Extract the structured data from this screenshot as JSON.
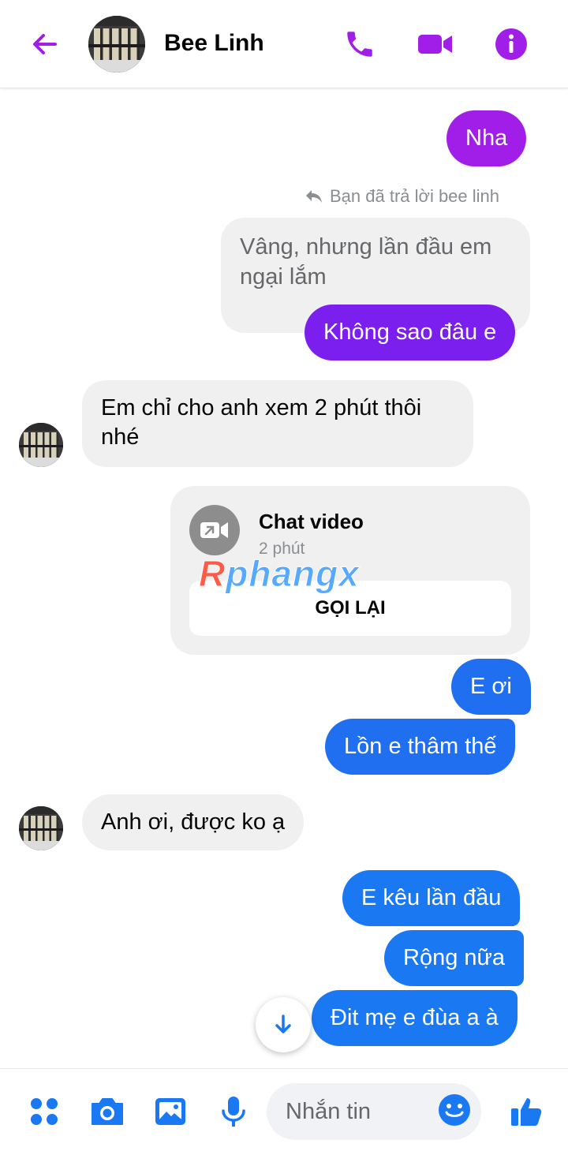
{
  "header": {
    "contact_name": "Bee Linh",
    "icons": [
      "back-arrow-icon",
      "phone-icon",
      "video-camera-icon",
      "info-icon"
    ]
  },
  "colors": {
    "accent": "#a11ee8",
    "violet": "#7b1fee",
    "blue": "#1f6ff0",
    "incoming_bg": "#f0f0f0"
  },
  "messages": {
    "m1": "Nha",
    "reply_note": "Bạn đã trả lời bee linh",
    "quoted": "Vâng, nhưng lần đầu em ngại lắm",
    "m2": "Không sao đâu e",
    "m3": "Em chỉ cho anh xem 2 phút thôi nhé",
    "call_title": "Chat video",
    "call_duration": "2 phút",
    "call_button": "GỌI LẠI",
    "m4": "E ơi",
    "m5": "Lồn e thâm thế",
    "m6": "Anh ơi, được ko ạ",
    "m7": "E kêu lần đầu",
    "m8": "Rộng nữa",
    "m9": "Đit mẹ e đùa a à"
  },
  "watermark": {
    "first": "R",
    "rest": "phangx"
  },
  "composer": {
    "placeholder": "Nhắn tin"
  }
}
